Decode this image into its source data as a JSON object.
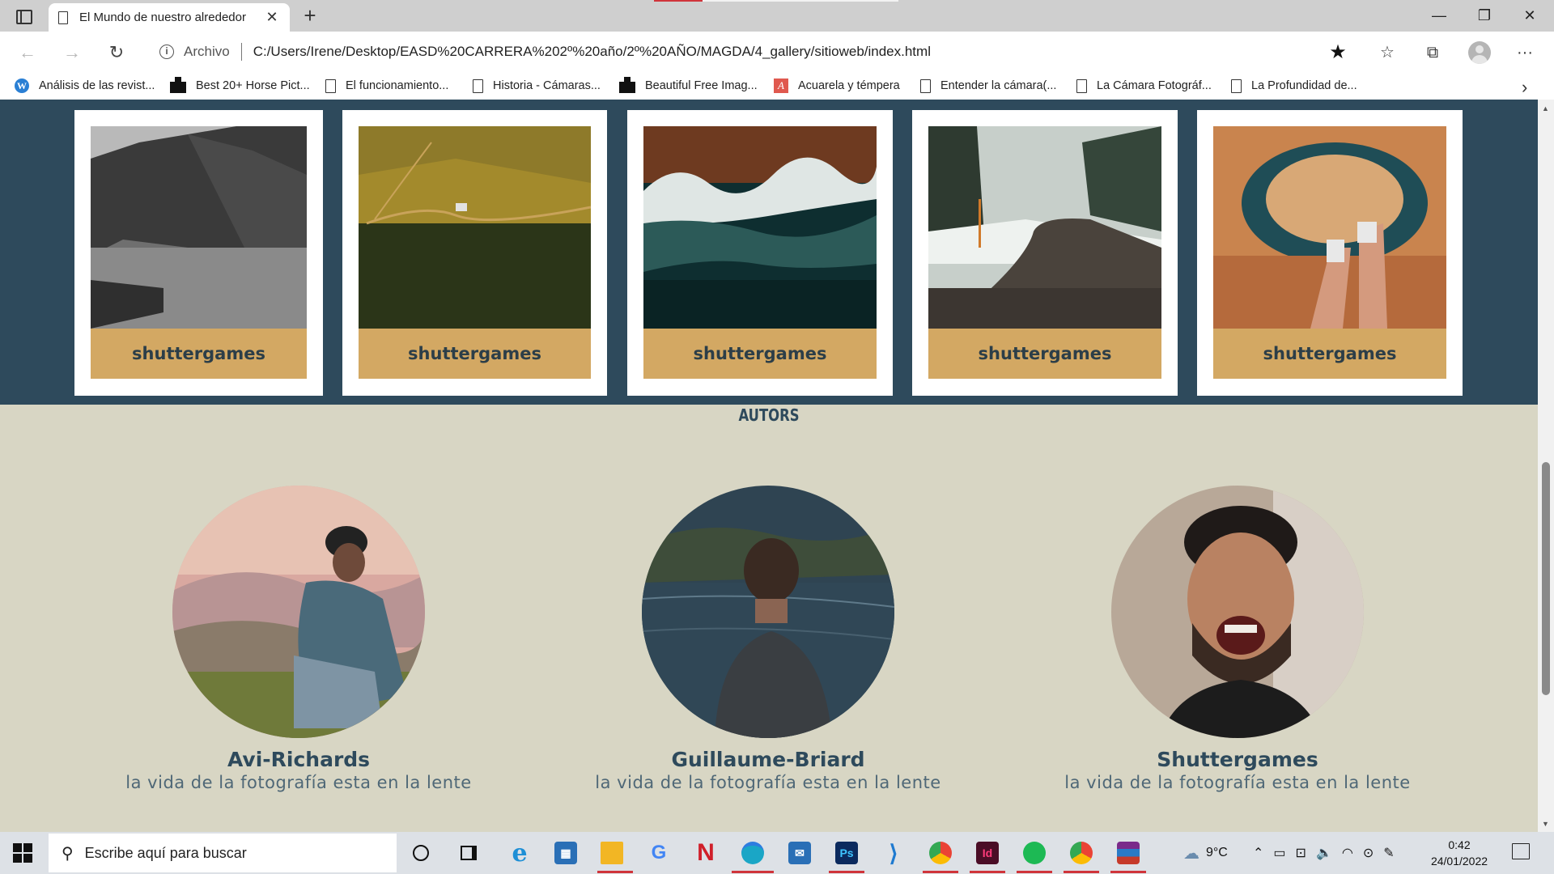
{
  "browser": {
    "tab_title": "El Mundo de nuestro alrededor",
    "tab_close": "✕",
    "new_tab": "+",
    "window_controls": {
      "minimize": "—",
      "restore": "❐",
      "close": "✕"
    },
    "site_label": "Archivo",
    "url": "C:/Users/Irene/Desktop/EASD%20CARRERA%202º%20año/2º%20AÑO/MAGDA/4_gallery/sitioweb/index.html",
    "more_menu": "···"
  },
  "bookmarks": [
    {
      "label": "Análisis de las revist...",
      "icon": "wordpress-icon"
    },
    {
      "label": "Best 20+ Horse Pict...",
      "icon": "unsplash-icon"
    },
    {
      "label": "El funcionamiento...",
      "icon": "document-icon"
    },
    {
      "label": "Historia - Cámaras...",
      "icon": "document-icon"
    },
    {
      "label": "Beautiful Free Imag...",
      "icon": "unsplash-icon"
    },
    {
      "label": "Acuarela y témpera",
      "icon": "acuarela-icon"
    },
    {
      "label": "Entender la cámara(...",
      "icon": "document-icon"
    },
    {
      "label": "La Cámara Fotográf...",
      "icon": "document-icon"
    },
    {
      "label": "La Profundidad de...",
      "icon": "document-icon"
    }
  ],
  "gallery": {
    "cards": [
      {
        "caption": "shuttergames",
        "scene": "rocky-cliff-lake"
      },
      {
        "caption": "shuttergames",
        "scene": "aerial-farmland"
      },
      {
        "caption": "shuttergames",
        "scene": "aerial-wave"
      },
      {
        "caption": "shuttergames",
        "scene": "snowy-road"
      },
      {
        "caption": "shuttergames",
        "scene": "horseshoe-bend"
      }
    ]
  },
  "autors": {
    "title": "AUTORS",
    "people": [
      {
        "name": "Avi-Richards",
        "tagline": "la vida de la fotografía esta en la lente"
      },
      {
        "name": "Guillaume-Briard",
        "tagline": "la vida de la fotografía esta en la lente"
      },
      {
        "name": "Shuttergames",
        "tagline": "la vida de la fotografía esta en la lente"
      }
    ]
  },
  "taskbar": {
    "search_placeholder": "Escribe aquí para buscar",
    "temperature": "9°C",
    "time": "0:42",
    "date": "24/01/2022",
    "apps": [
      "cortana-icon",
      "task-view-icon",
      "internet-explorer-icon",
      "microsoft-store-icon",
      "file-explorer-icon",
      "google-icon",
      "netflix-icon",
      "edge-icon",
      "mail-icon",
      "photoshop-icon",
      "vscode-icon",
      "chrome-icon",
      "indesign-icon",
      "spotify-icon",
      "chrome-profile-icon",
      "winrar-icon"
    ]
  },
  "colors": {
    "gallery_band": "#2e4a5c",
    "caption_bg": "#d3a863",
    "page_bg": "#d8d6c4",
    "heading": "#2e4a5c"
  }
}
